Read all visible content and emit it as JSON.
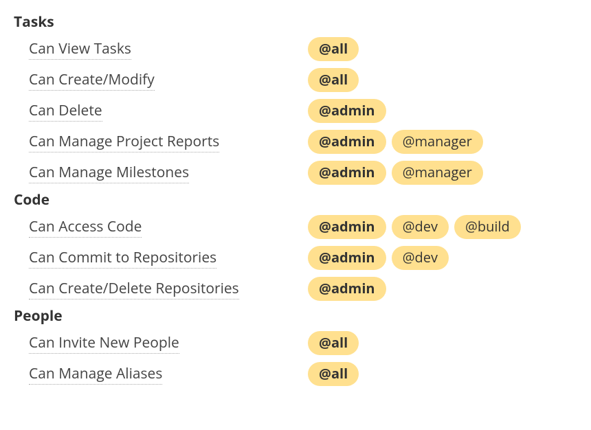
{
  "sections": [
    {
      "title": "Tasks",
      "permissions": [
        {
          "label": "Can View Tasks",
          "tags": [
            {
              "text": "@all",
              "primary": true
            }
          ]
        },
        {
          "label": "Can Create/Modify",
          "tags": [
            {
              "text": "@all",
              "primary": true
            }
          ]
        },
        {
          "label": "Can Delete",
          "tags": [
            {
              "text": "@admin",
              "primary": true
            }
          ]
        },
        {
          "label": "Can Manage Project Reports",
          "tags": [
            {
              "text": "@admin",
              "primary": true
            },
            {
              "text": "@manager",
              "primary": false
            }
          ]
        },
        {
          "label": "Can Manage Milestones",
          "tags": [
            {
              "text": "@admin",
              "primary": true
            },
            {
              "text": "@manager",
              "primary": false
            }
          ]
        }
      ]
    },
    {
      "title": "Code",
      "permissions": [
        {
          "label": "Can Access Code",
          "tags": [
            {
              "text": "@admin",
              "primary": true
            },
            {
              "text": "@dev",
              "primary": false
            },
            {
              "text": "@build",
              "primary": false
            }
          ]
        },
        {
          "label": "Can Commit to Repositories",
          "tags": [
            {
              "text": "@admin",
              "primary": true
            },
            {
              "text": "@dev",
              "primary": false
            }
          ]
        },
        {
          "label": "Can Create/Delete Repositories",
          "tags": [
            {
              "text": "@admin",
              "primary": true
            }
          ]
        }
      ]
    },
    {
      "title": "People",
      "permissions": [
        {
          "label": "Can Invite New People",
          "tags": [
            {
              "text": "@all",
              "primary": true
            }
          ]
        },
        {
          "label": "Can Manage Aliases",
          "tags": [
            {
              "text": "@all",
              "primary": true
            }
          ]
        }
      ]
    }
  ]
}
